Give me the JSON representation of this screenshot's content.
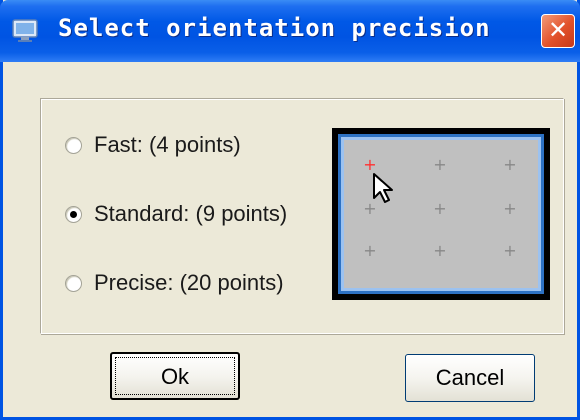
{
  "window": {
    "title": "Select orientation precision",
    "app_icon": "monitor-icon",
    "close_glyph": "✕"
  },
  "options": [
    {
      "label": "Fast: (4 points)",
      "selected": false
    },
    {
      "label": "Standard: (9 points)",
      "selected": true
    },
    {
      "label": "Precise: (20 points)",
      "selected": false
    }
  ],
  "preview": {
    "grid_marker": "+",
    "active_point_color": "#ff3030",
    "inactive_point_color": "#888888",
    "cursor": "arrow-cursor-icon"
  },
  "buttons": {
    "ok_label": "Ok",
    "cancel_label": "Cancel"
  },
  "colors": {
    "titlebar": "#0054e3",
    "dialog_bg": "#ece9d8",
    "close_button": "#e2512a"
  }
}
